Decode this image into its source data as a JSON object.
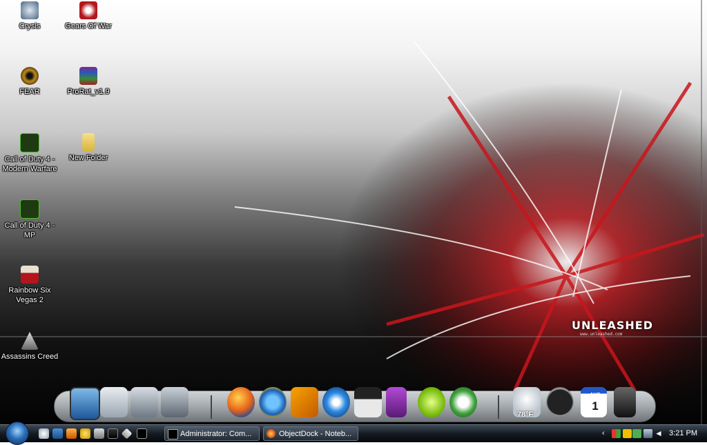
{
  "desktop": {
    "icons": [
      {
        "label": "Crysis"
      },
      {
        "label": "Gears Of War"
      },
      {
        "label": "FEAR"
      },
      {
        "label": "ProRat_v1.9"
      },
      {
        "label": "Call of Duty 4 - Modern Warfare"
      },
      {
        "label": "New Folder"
      },
      {
        "label": "Call of Duty 4 - MP"
      },
      {
        "label": "Rainbow Six Vegas 2"
      },
      {
        "label": "Assassins Creed"
      }
    ]
  },
  "wallpaper": {
    "logo_text": "UNLEASHED",
    "sub_text": "www.unleashed.com"
  },
  "dock": {
    "weather_temp": "78°F",
    "calendar_month": "AUG",
    "calendar_day": "1",
    "items": [
      {
        "icon": "desktop-icon"
      },
      {
        "icon": "documents-icon"
      },
      {
        "icon": "pictures-icon"
      },
      {
        "icon": "music-icon"
      },
      {
        "icon": "firefox-icon"
      },
      {
        "icon": "internet-explorer-icon"
      },
      {
        "icon": "winamp-icon"
      },
      {
        "icon": "windows-media-player-icon"
      },
      {
        "icon": "media-player-classic-icon"
      },
      {
        "icon": "ipod-icon"
      },
      {
        "icon": "limewire-icon"
      },
      {
        "icon": "utorrent-icon"
      },
      {
        "icon": "weather-icon"
      },
      {
        "icon": "clock-icon"
      },
      {
        "icon": "calendar-icon"
      },
      {
        "icon": "recycle-bin-icon"
      }
    ]
  },
  "taskbar": {
    "buttons": [
      {
        "label": "Administrator: Com..."
      },
      {
        "label": "ObjectDock - Noteb..."
      }
    ],
    "clock": "3:21 PM"
  },
  "colors": {
    "accent_red": "#b3161b",
    "taskbar_dark": "#151b22"
  }
}
